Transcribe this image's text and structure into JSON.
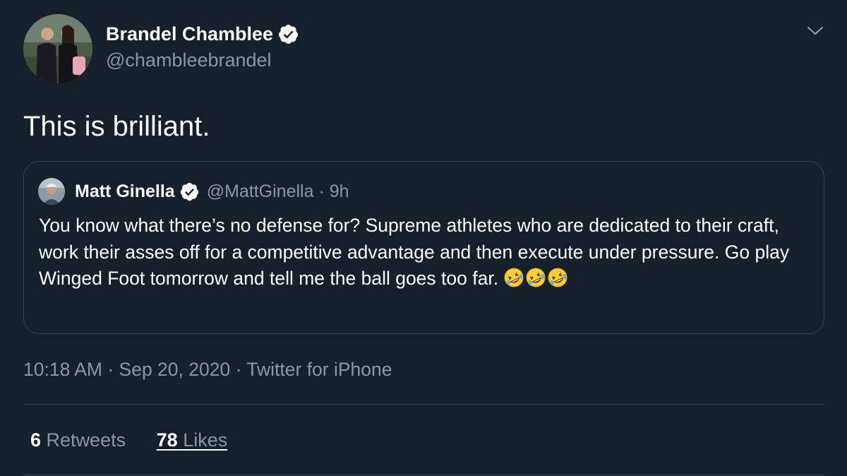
{
  "tweet": {
    "author": {
      "name": "Brandel Chamblee",
      "handle": "@chambleebrandel",
      "verified": true
    },
    "text": "This is brilliant.",
    "quoted": {
      "name": "Matt Ginella",
      "handle": "@MattGinella",
      "time": "9h",
      "text": "You know what there’s no defense for? Supreme athletes who are dedicated to their craft, work their asses off for a competitive advantage and then execute under pressure. Go play Winged Foot tomorrow and tell me the ball goes too far.",
      "emojis": [
        "rolling-on-floor-laughing-emoji",
        "rolling-on-floor-laughing-emoji",
        "rolling-on-floor-laughing-emoji"
      ],
      "verified": true
    },
    "meta": {
      "time": "10:18 AM",
      "date": "Sep 20, 2020",
      "source": "Twitter for iPhone"
    },
    "stats": {
      "retweets_count": "6",
      "retweets_label": "Retweets",
      "likes_count": "78",
      "likes_label": "Likes"
    }
  },
  "colors": {
    "background": "#15202b",
    "primary_text": "#ffffff",
    "secondary_text": "#8899a6",
    "border": "#38444d",
    "verified_badge": "#ffffff"
  },
  "icons": {
    "verified": "verified-badge-icon",
    "caret": "chevron-down-icon",
    "emoji": "rolling-on-floor-laughing-emoji"
  }
}
